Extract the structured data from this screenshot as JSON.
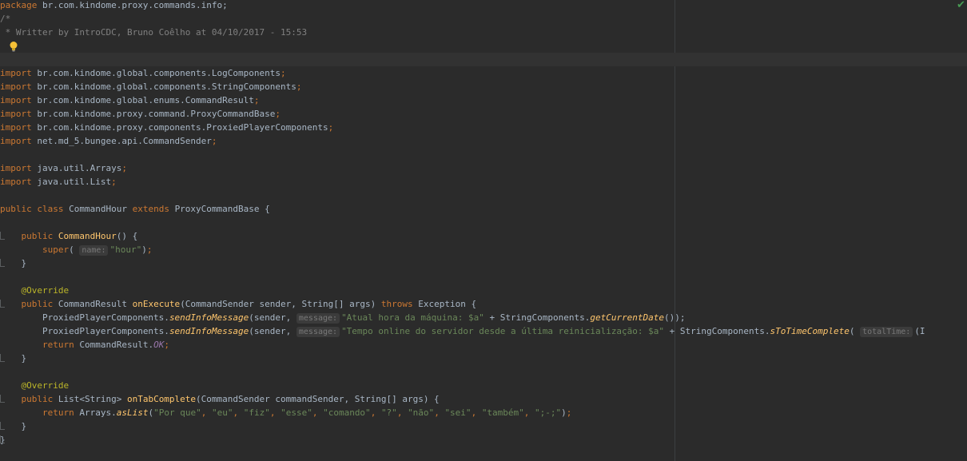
{
  "editor": {
    "status_icon": "check-icon",
    "lines": {
      "l1_kw": "package",
      "l1_rest": " br.com.kindome.proxy.commands.info;",
      "l2": "/*",
      "l3": " * Writter by IntroCDC, Bruno Coêlho at 04/10/2017 - 15:53",
      "imp1": "br.com.kindome.global.components.LogComponents",
      "imp2": "br.com.kindome.global.components.StringComponents",
      "imp3": "br.com.kindome.global.enums.CommandResult",
      "imp4": "br.com.kindome.proxy.command.ProxyCommandBase",
      "imp5": "br.com.kindome.proxy.components.ProxiedPlayerComponents",
      "imp6": "net.md_5.bungee.api.CommandSender",
      "imp7": "java.util.Arrays",
      "imp8": "java.util.List",
      "import_kw": "import",
      "class_name": "CommandHour",
      "base_class": "ProxyCommandBase",
      "ctor_name": "CommandHour",
      "super_kw": "super",
      "hint_name": "name:",
      "str_hour": "\"hour\"",
      "override": "@Override",
      "ret_type": "CommandResult",
      "on_execute": "onExecute",
      "exec_params": "(CommandSender sender, String[] args) ",
      "throws_kw": "throws",
      "exception": " Exception {",
      "ppc": "ProxiedPlayerComponents.",
      "send_info": "sendInfoMessage",
      "sender_arg": "(sender, ",
      "hint_message": "message:",
      "str_atual": "\"Atual hora da máquina: $a\"",
      "plus_sc": " + StringComponents.",
      "get_date": "getCurrentDate",
      "close1": "());",
      "str_tempo": "\"Tempo online do servidor desde a última reinicialização: $a\"",
      "s_to_time": "sToTimeComplete",
      "hint_total": "totalTime:",
      "tail": "(I",
      "return_kw": "return",
      "cr_ok_prefix": " CommandResult.",
      "ok_const": "OK",
      "list_type": "List<String> ",
      "on_tab": "onTabComplete",
      "tab_params": "(CommandSender commandSender, String[] args) {",
      "arrays_prefix": " Arrays.",
      "as_list": "asList",
      "s1": "\"Por que\"",
      "s2": "\"eu\"",
      "s3": "\"fiz\"",
      "s4": "\"esse\"",
      "s5": "\"comando\"",
      "s6": "\"?\"",
      "s7": "\"não\"",
      "s8": "\"sei\"",
      "s9": "\"também\"",
      "s10": "\";-;\""
    }
  }
}
